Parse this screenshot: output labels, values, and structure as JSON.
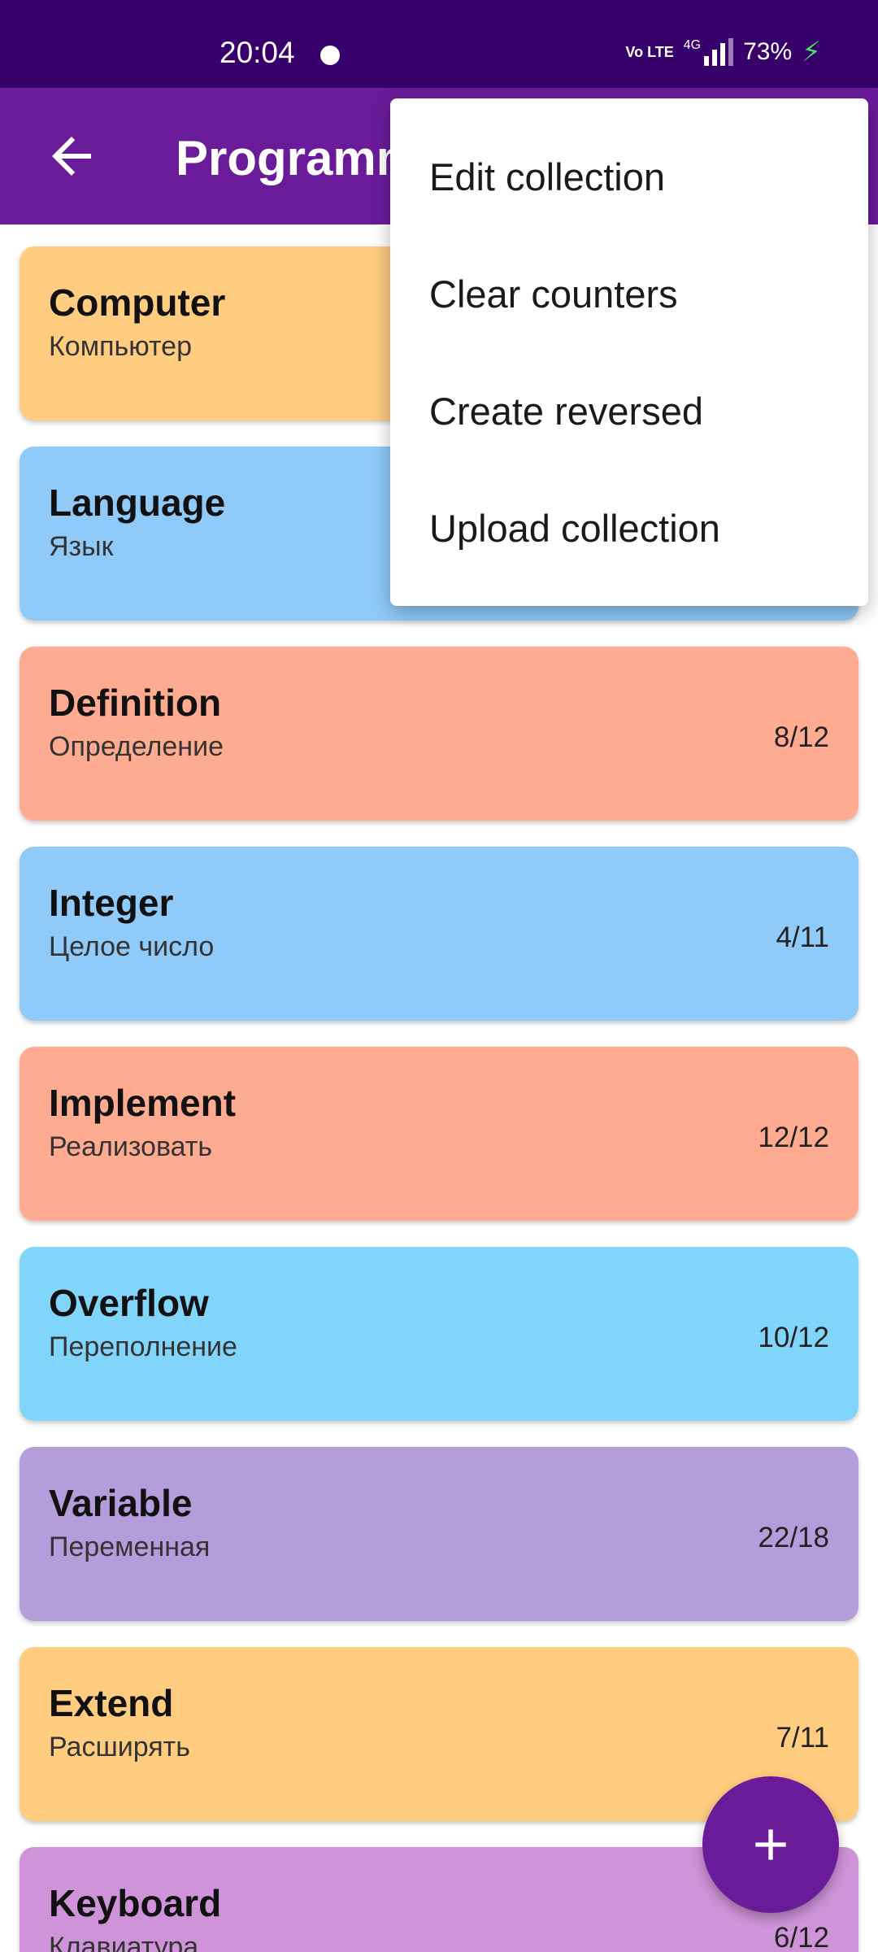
{
  "status_bar": {
    "time": "20:04",
    "network": "4G",
    "volte": "Vo LTE",
    "battery": "73%"
  },
  "app_bar": {
    "title": "Programming"
  },
  "cards": [
    {
      "word": "Computer",
      "translation": "Компьютер",
      "count": "",
      "color": "#ffcc80"
    },
    {
      "word": "Language",
      "translation": "Язык",
      "count": "",
      "color": "#90caf9"
    },
    {
      "word": "Definition",
      "translation": "Определение",
      "count": "8/12",
      "color": "#ffab91"
    },
    {
      "word": "Integer",
      "translation": "Целое число",
      "count": "4/11",
      "color": "#90caf9"
    },
    {
      "word": "Implement",
      "translation": "Реализовать",
      "count": "12/12",
      "color": "#ffab91"
    },
    {
      "word": "Overflow",
      "translation": "Переполнение",
      "count": "10/12",
      "color": "#81d4fa"
    },
    {
      "word": "Variable",
      "translation": "Переменная",
      "count": "22/18",
      "color": "#b39ddb"
    },
    {
      "word": "Extend",
      "translation": "Расширять",
      "count": "7/11",
      "color": "#ffcc80"
    },
    {
      "word": "Keyboard",
      "translation": "Клавиатура",
      "count": "6/12",
      "color": "#ce93d8"
    }
  ],
  "menu": {
    "items": [
      "Edit collection",
      "Clear counters",
      "Create reversed",
      "Upload collection"
    ]
  },
  "fab": {
    "icon": "plus-icon"
  },
  "colors": {
    "status_bar": "#38006b",
    "app_bar": "#6a1b9a",
    "fab": "#6a1b9a"
  }
}
